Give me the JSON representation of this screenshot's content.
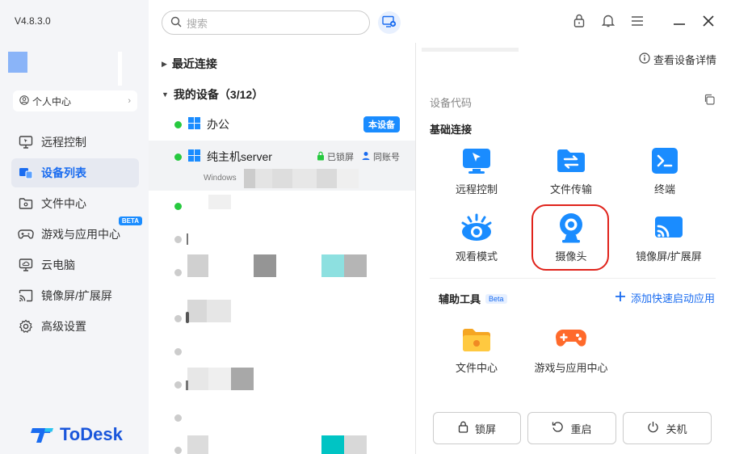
{
  "app": {
    "version": "V4.8.3.0",
    "logo_text": "ToDesk"
  },
  "sidebar": {
    "profile_label": "个人中心",
    "items": [
      {
        "label": "远程控制",
        "icon": "monitor-icon",
        "active": false
      },
      {
        "label": "设备列表",
        "icon": "devices-icon",
        "active": true
      },
      {
        "label": "文件中心",
        "icon": "folder-icon",
        "active": false
      },
      {
        "label": "游戏与应用中心",
        "icon": "gamepad-icon",
        "active": false,
        "badge": "BETA"
      },
      {
        "label": "云电脑",
        "icon": "cloud-pc-icon",
        "active": false
      },
      {
        "label": "镜像屏/扩展屏",
        "icon": "cast-icon",
        "active": false
      },
      {
        "label": "高级设置",
        "icon": "gear-icon",
        "active": false
      }
    ]
  },
  "search": {
    "placeholder": "搜索"
  },
  "devicelist": {
    "recent_label": "最近连接",
    "my_devices_label": "我的设备（3/12）",
    "devices": [
      {
        "name": "办公",
        "online": true,
        "tag": "本设备"
      },
      {
        "name": "纯主机server",
        "online": true,
        "lock_label": "已锁屏",
        "account_label": "同账号",
        "os": "Windows"
      }
    ]
  },
  "detail": {
    "view_details": "查看设备详情",
    "device_code_label": "设备代码",
    "basic_label": "基础连接",
    "basic": [
      {
        "label": "远程控制",
        "icon": "remote-control-icon"
      },
      {
        "label": "文件传输",
        "icon": "file-transfer-icon"
      },
      {
        "label": "终端",
        "icon": "terminal-icon"
      },
      {
        "label": "观看模式",
        "icon": "eye-icon"
      },
      {
        "label": "摄像头",
        "icon": "camera-icon"
      },
      {
        "label": "镜像屏/扩展屏",
        "icon": "cast-icon"
      }
    ],
    "tools_label": "辅助工具",
    "tools_badge": "Beta",
    "add_quick": "添加快速启动应用",
    "tools": [
      {
        "label": "文件中心",
        "icon": "folder-icon"
      },
      {
        "label": "游戏与应用中心",
        "icon": "gamepad-icon"
      }
    ],
    "buttons": {
      "lock": "锁屏",
      "restart": "重启",
      "shutdown": "关机"
    }
  },
  "colors": {
    "accent": "#1a6cf0",
    "online": "#27c93f",
    "highlight": "#e0231b"
  }
}
